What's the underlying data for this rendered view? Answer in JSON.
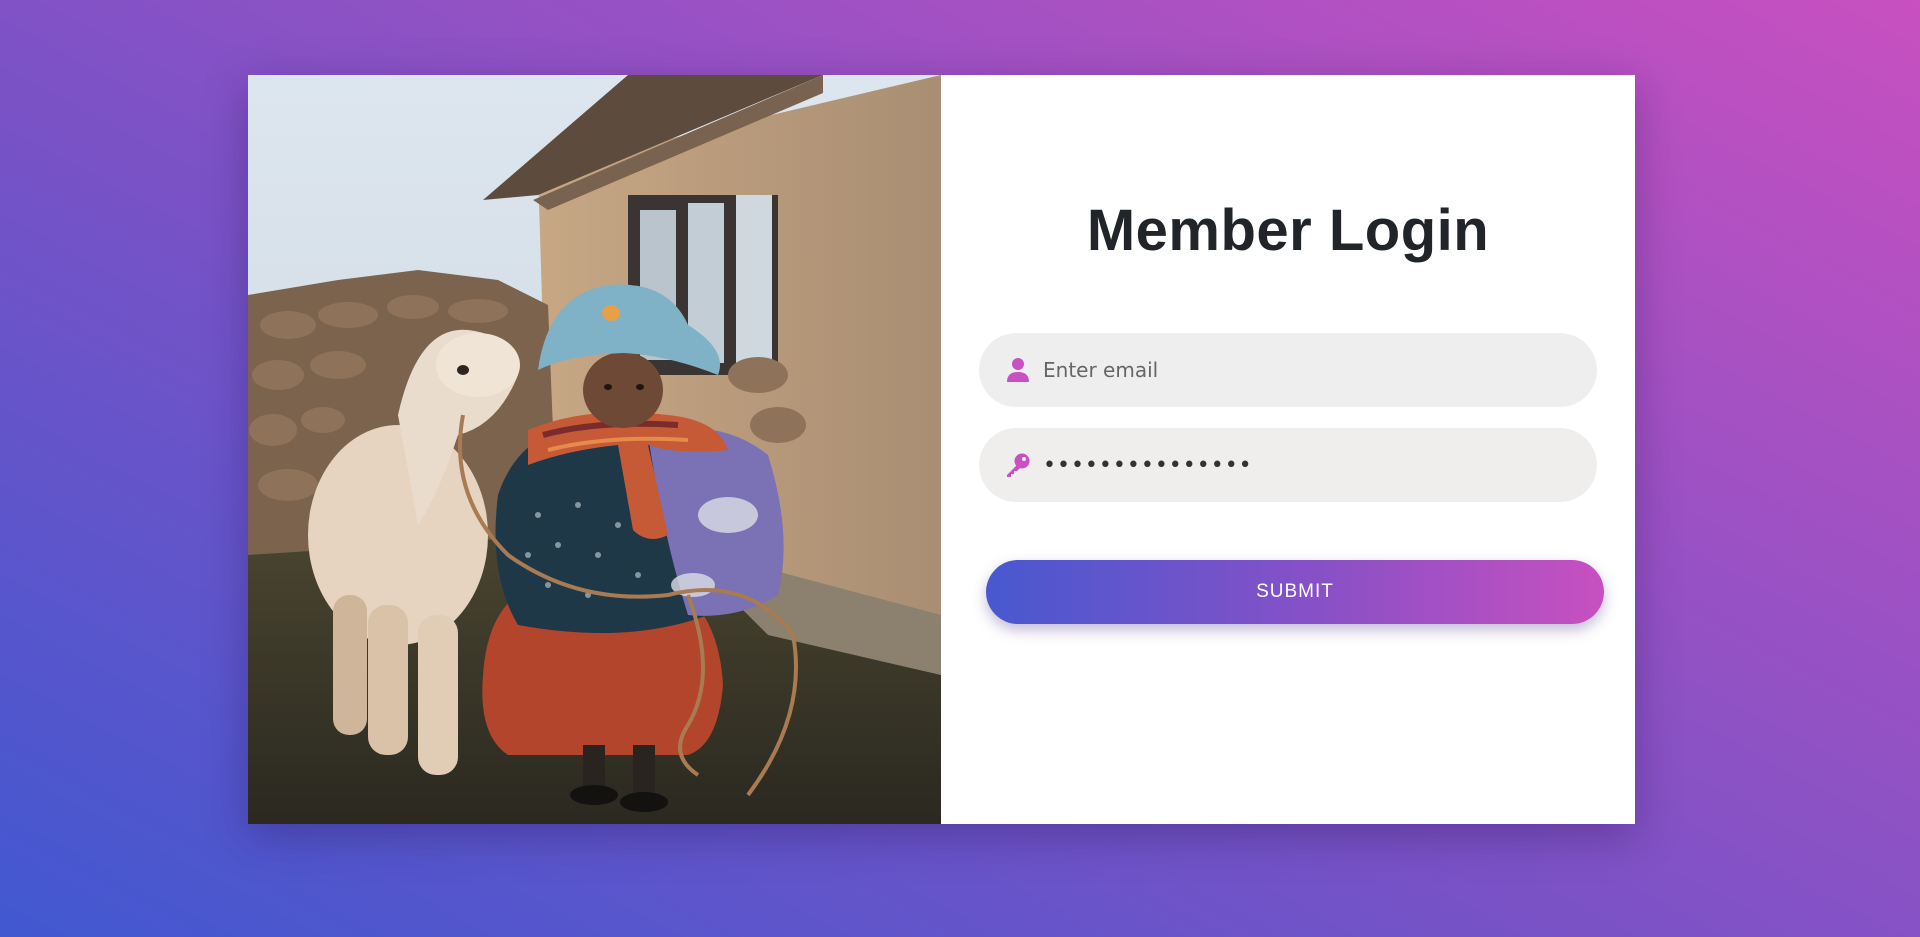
{
  "form": {
    "title": "Member Login",
    "email": {
      "placeholder": "Enter email",
      "icon": "user-icon"
    },
    "password": {
      "value": "•••••••••••••••",
      "icon": "key-icon"
    },
    "submit_label": "SUBMIT"
  },
  "colors": {
    "accent": "#c850c0",
    "gradient_start": "#4158d0",
    "gradient_end": "#c850c0",
    "title": "#212529",
    "field_bg": "#eeeeee"
  }
}
